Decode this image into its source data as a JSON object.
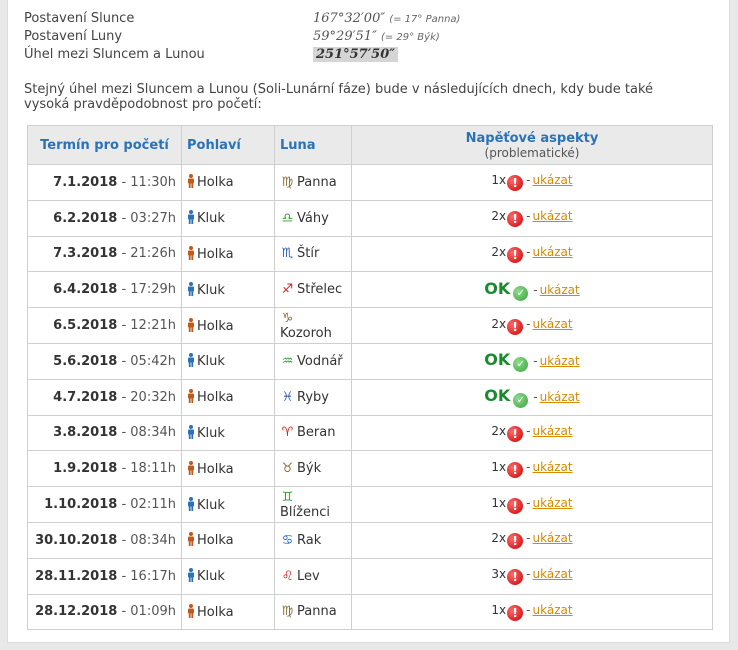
{
  "summary": {
    "sun_label": "Postavení Slunce",
    "sun_value": "167°32′00″",
    "sun_note": "(= 17° Panna)",
    "moon_label": "Postavení Luny",
    "moon_value": "59°29′51″",
    "moon_note": "(= 29° Býk)",
    "angle_label": "Úhel mezi Sluncem a Lunou",
    "angle_value": "251°57′50″"
  },
  "intro_text": "Stejný úhel mezi Sluncem a Lunou (Soli-Lunární fáze) bude v následujících dnech, kdy bude také vysoká pravděpodobnost pro početí:",
  "table": {
    "headers": {
      "date": "Termín pro početí",
      "gender": "Pohlaví",
      "moon": "Luna",
      "aspects": "Napěťové aspekty",
      "aspects_sub": "(problematické)"
    },
    "link_label": "ukázat",
    "ok_label": "OK",
    "dash": "-",
    "rows": [
      {
        "date": "7.1.2018",
        "time": " - 11:30h",
        "gender": "Holka",
        "gender_color": "#c05a1a",
        "sign_glyph": "♍",
        "sign": "Panna",
        "sign_color": "#8a6d3b",
        "count": "1x",
        "status": "warn"
      },
      {
        "date": "6.2.2018",
        "time": " - 03:27h",
        "gender": "Kluk",
        "gender_color": "#2a73b8",
        "sign_glyph": "♎",
        "sign": "Váhy",
        "sign_color": "#3a9a3a",
        "count": "2x",
        "status": "warn"
      },
      {
        "date": "7.3.2018",
        "time": " - 21:26h",
        "gender": "Holka",
        "gender_color": "#c05a1a",
        "sign_glyph": "♏",
        "sign": "Štír",
        "sign_color": "#2a5fb8",
        "count": "2x",
        "status": "warn"
      },
      {
        "date": "6.4.2018",
        "time": " - 17:29h",
        "gender": "Kluk",
        "gender_color": "#2a73b8",
        "sign_glyph": "♐",
        "sign": "Střelec",
        "sign_color": "#d02020",
        "count": "",
        "status": "ok"
      },
      {
        "date": "6.5.2018",
        "time": " - 12:21h",
        "gender": "Holka",
        "gender_color": "#c05a1a",
        "sign_glyph": "♑",
        "sign": "Kozoroh",
        "sign_color": "#8a6d3b",
        "count": "2x",
        "status": "warn"
      },
      {
        "date": "5.6.2018",
        "time": " - 05:42h",
        "gender": "Kluk",
        "gender_color": "#2a73b8",
        "sign_glyph": "♒",
        "sign": "Vodnář",
        "sign_color": "#3a9a3a",
        "count": "",
        "status": "ok"
      },
      {
        "date": "4.7.2018",
        "time": " - 20:32h",
        "gender": "Holka",
        "gender_color": "#c05a1a",
        "sign_glyph": "♓",
        "sign": "Ryby",
        "sign_color": "#2a5fb8",
        "count": "",
        "status": "ok"
      },
      {
        "date": "3.8.2018",
        "time": " - 08:34h",
        "gender": "Kluk",
        "gender_color": "#2a73b8",
        "sign_glyph": "♈",
        "sign": "Beran",
        "sign_color": "#d02020",
        "count": "2x",
        "status": "warn"
      },
      {
        "date": "1.9.2018",
        "time": " - 18:11h",
        "gender": "Holka",
        "gender_color": "#c05a1a",
        "sign_glyph": "♉",
        "sign": "Býk",
        "sign_color": "#8a6d3b",
        "count": "1x",
        "status": "warn"
      },
      {
        "date": "1.10.2018",
        "time": " - 02:11h",
        "gender": "Kluk",
        "gender_color": "#2a73b8",
        "sign_glyph": "♊",
        "sign": "Blíženci",
        "sign_color": "#3a9a3a",
        "count": "1x",
        "status": "warn"
      },
      {
        "date": "30.10.2018",
        "time": " - 08:34h",
        "gender": "Holka",
        "gender_color": "#c05a1a",
        "sign_glyph": "♋",
        "sign": "Rak",
        "sign_color": "#2a5fb8",
        "count": "2x",
        "status": "warn"
      },
      {
        "date": "28.11.2018",
        "time": " - 16:17h",
        "gender": "Kluk",
        "gender_color": "#2a73b8",
        "sign_glyph": "♌",
        "sign": "Lev",
        "sign_color": "#d02020",
        "count": "3x",
        "status": "warn"
      },
      {
        "date": "28.12.2018",
        "time": " - 01:09h",
        "gender": "Holka",
        "gender_color": "#c05a1a",
        "sign_glyph": "♍",
        "sign": "Panna",
        "sign_color": "#8a6d3b",
        "count": "1x",
        "status": "warn"
      }
    ]
  },
  "icons": {
    "gender": "person-icon",
    "warn": "exclamation-icon",
    "ok": "check-icon"
  }
}
